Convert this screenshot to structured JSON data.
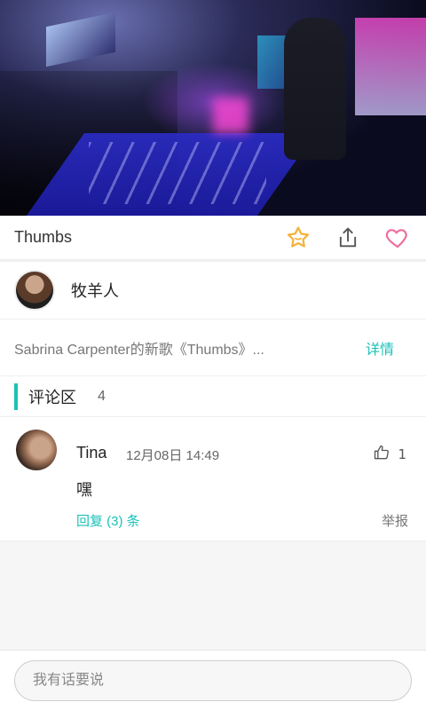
{
  "video": {
    "alt_label": ""
  },
  "header": {
    "title": "Thumbs",
    "icons": [
      "star-icon",
      "share-icon",
      "heart-icon"
    ]
  },
  "author": {
    "name": "牧羊人"
  },
  "description": {
    "text": "Sabrina Carpenter的新歌《Thumbs》...",
    "detail_label": "详情"
  },
  "comments_section": {
    "label": "评论区",
    "count": "4"
  },
  "comments": [
    {
      "name": "Tina",
      "time": "12月08日 14:49",
      "likes": "1",
      "text": "嘿",
      "reply_label": "回复 (3) 条",
      "report_label": "举报"
    }
  ],
  "input": {
    "placeholder": "我有话要说"
  },
  "colors": {
    "accent": "#19c2b8",
    "star": "#f3b23a",
    "heart": "#ef6fa0"
  }
}
